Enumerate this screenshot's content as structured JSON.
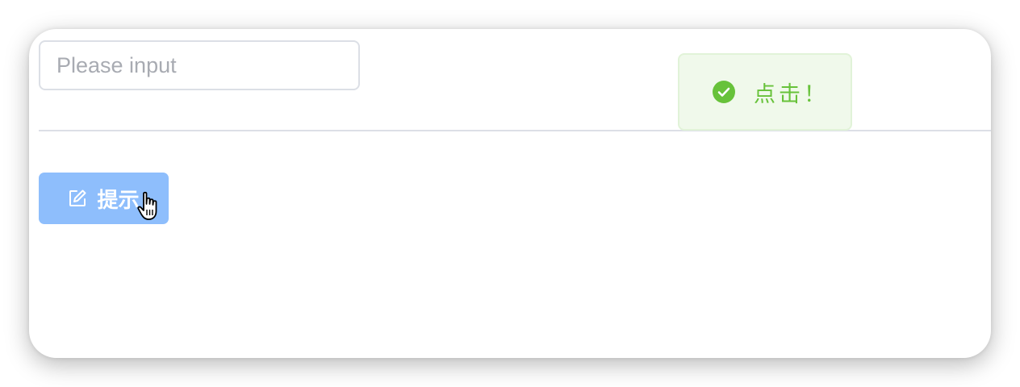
{
  "input": {
    "value": "",
    "placeholder": "Please input"
  },
  "button": {
    "label": "提示",
    "icon": "edit-icon"
  },
  "message": {
    "type": "success",
    "icon": "success-check-icon",
    "text": "点击！"
  },
  "colors": {
    "button_bg": "#8ebefc",
    "success": "#67c23a",
    "success_bg": "#f0f9eb",
    "border": "#dcdfe6"
  }
}
